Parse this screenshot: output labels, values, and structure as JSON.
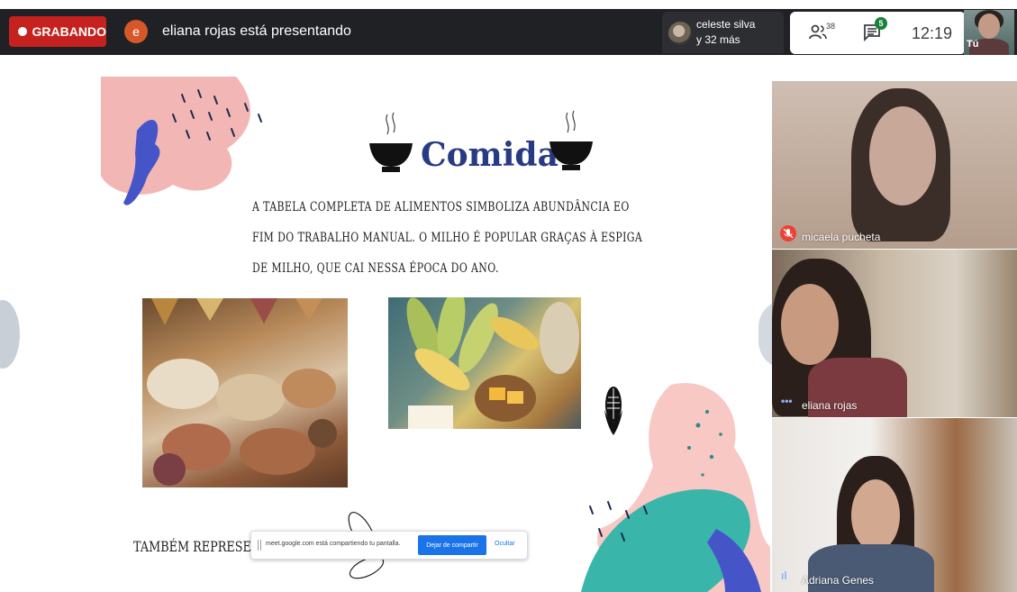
{
  "topbar": {
    "recording_label": "GRABANDO",
    "presenter_initial": "e",
    "presenter_text": "eliana rojas está presentando",
    "viewers": {
      "name": "celeste silva",
      "more": "y 32 más"
    },
    "participants_count": "38",
    "chat_badge": "5",
    "clock": "12:19",
    "self_label": "Tú"
  },
  "slide": {
    "title": "Comida",
    "body": "A tabela completa de alimentos simboliza abundância eo fim do trabalho manual. O milho é popular graças à espiga de milho, que cai nessa época do ano.",
    "bottom_text": "Também representa ex"
  },
  "share_bar": {
    "message": "meet.google.com está compartiendo tu pantalla.",
    "stop_label": "Dejar de compartir",
    "hide_label": "Ocultar"
  },
  "tiles": [
    {
      "name": "micaela pucheta"
    },
    {
      "name": "eliana rojas"
    },
    {
      "name": "Adriana Genes"
    }
  ],
  "colors": {
    "topbar_bg": "#202124",
    "recording": "#c5221f",
    "slide_title": "#283a83",
    "accent_blue": "#1a73e8",
    "chat_badge": "#188038",
    "mic_off": "#ea4335"
  },
  "icons": [
    "people-icon",
    "chat-icon",
    "mic-off-icon",
    "audio-level-icon",
    "bowl-icon",
    "corn-icon"
  ]
}
